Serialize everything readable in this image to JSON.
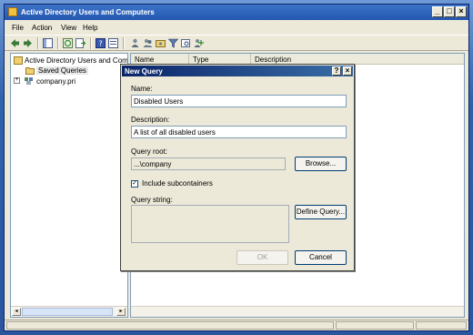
{
  "window": {
    "title": "Active Directory Users and Computers",
    "minimize": "_",
    "maximize": "□",
    "close": "×"
  },
  "menu": [
    "File",
    "Action",
    "View",
    "Help"
  ],
  "tree": {
    "root": "Active Directory Users and Comput",
    "saved_queries": "Saved Queries",
    "domain": "company.pri",
    "expander": "+"
  },
  "list": {
    "columns": [
      "Name",
      "Type",
      "Description"
    ]
  },
  "dialog": {
    "title": "New Query",
    "help": "?",
    "close": "×",
    "name_label": "Name:",
    "name_value": "Disabled Users",
    "description_label": "Description:",
    "description_value": "A list of all disabled users",
    "query_root_label": "Query root:",
    "query_root_value": "...\\company",
    "browse_button": "Browse...",
    "include_subcontainers_label": "Include subcontainers",
    "include_subcontainers_checked": true,
    "check_mark": "✓",
    "query_string_label": "Query string:",
    "query_string_value": "",
    "define_query_button": "Define Query...",
    "ok_button": "OK",
    "cancel_button": "Cancel"
  },
  "scroll": {
    "left": "◂",
    "right": "▸"
  },
  "colors": {
    "title_bar": "#2458b0",
    "dialog_title": "#0a246a",
    "window_bg": "#ece9d8"
  }
}
